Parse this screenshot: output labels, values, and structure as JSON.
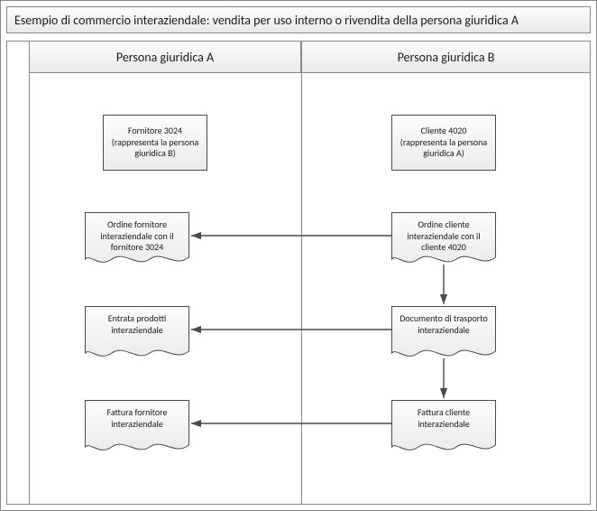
{
  "title": "Esempio di commercio interaziendale: vendita per uso interno o rivendita della persona giuridica A",
  "columns": {
    "a": "Persona giuridica A",
    "b": "Persona giuridica B"
  },
  "nodes": {
    "supplier": "Fornitore 3024 (rappresenta la persona giuridica B)",
    "customer": "Cliente 4020 (rappresenta la persona giuridica A)",
    "po": "Ordine fornitore interaziendale con il fornitore 3024",
    "so": "Ordine cliente interaziendale con il cliente 4020",
    "receipt": "Entrata prodotti interaziendale",
    "packing": "Documento di trasporto interaziendale",
    "vinvoice": "Fattura fornitore interaziendale",
    "cinvoice": "Fattura cliente interaziendale"
  }
}
